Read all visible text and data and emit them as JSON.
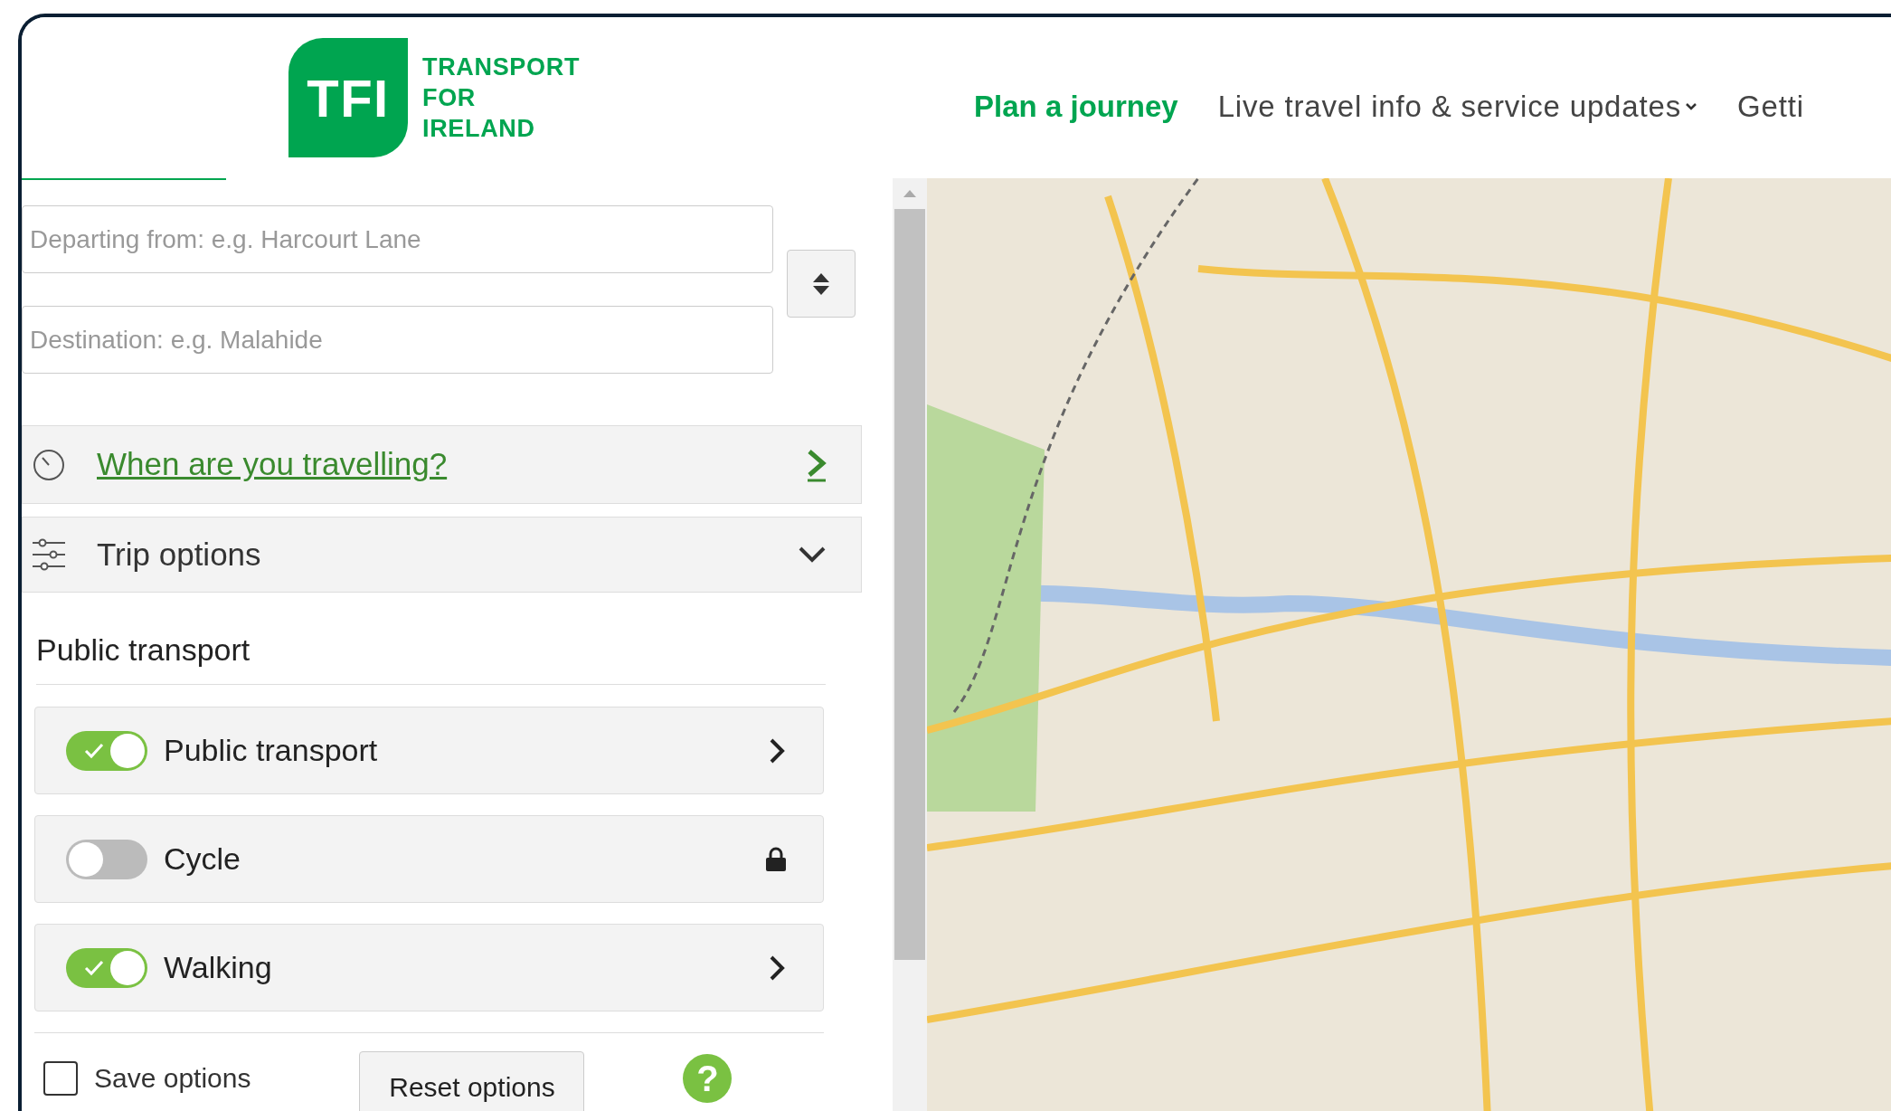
{
  "logo": {
    "mark": "TFI",
    "lines": [
      "TRANSPORT",
      "FOR",
      "IRELAND"
    ]
  },
  "nav": [
    {
      "label": "Plan a journey",
      "selected": true,
      "dropdown": false
    },
    {
      "label": "Live travel info & service updates",
      "selected": false,
      "dropdown": true
    },
    {
      "label": "Getti",
      "selected": false,
      "dropdown": false
    }
  ],
  "journey": {
    "from_placeholder": "Departing from: e.g. Harcourt Lane",
    "to_placeholder": "Destination: e.g. Malahide"
  },
  "when": {
    "label": "When are you travelling?"
  },
  "trip_options": {
    "title": "Trip options",
    "expanded": true
  },
  "section_title": "Public transport",
  "modes": [
    {
      "label": "Public transport",
      "on": true,
      "kind": "chevron"
    },
    {
      "label": "Cycle",
      "on": false,
      "kind": "lock"
    },
    {
      "label": "Walking",
      "on": true,
      "kind": "chevron"
    }
  ],
  "save_options": {
    "label": "Save options",
    "checked": false
  },
  "reset_button": "Reset options",
  "help": "?"
}
